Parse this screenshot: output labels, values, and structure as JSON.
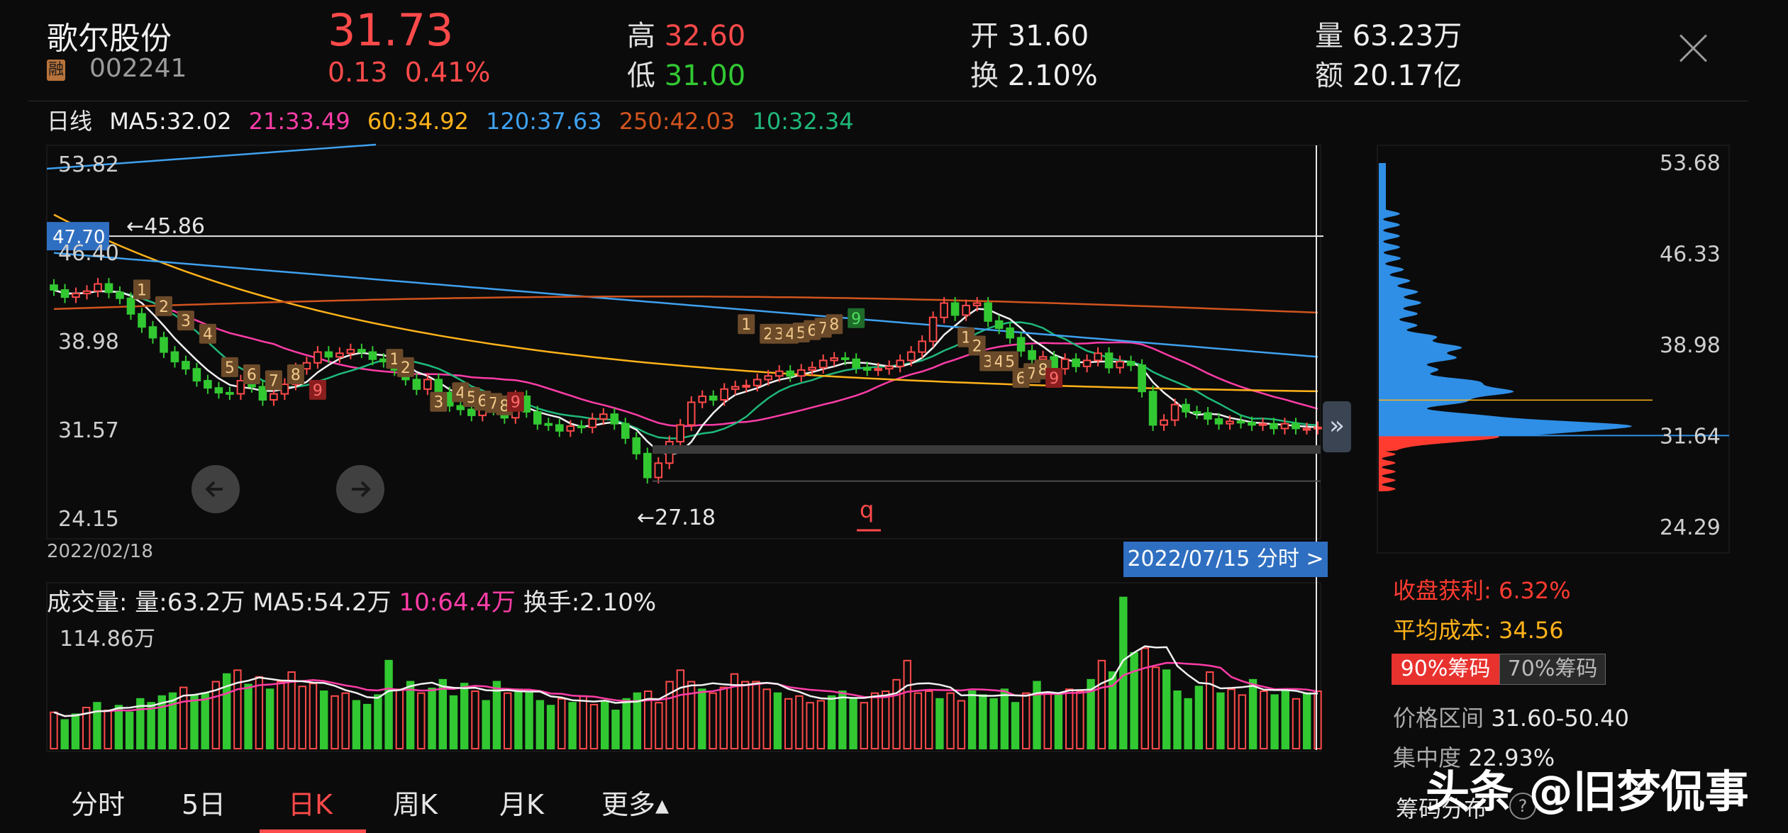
{
  "header": {
    "stock_name": "歌尔股份",
    "badge": "融",
    "code": "002241",
    "price": "31.73",
    "change": "0.13",
    "change_pct": "0.41%",
    "high_label": "高",
    "high": "32.60",
    "low_label": "低",
    "low": "31.00",
    "open_label": "开",
    "open": "31.60",
    "turnover_label": "换",
    "turnover": "2.10%",
    "volume_label": "量",
    "volume": "63.23万",
    "amount_label": "额",
    "amount": "20.17亿"
  },
  "ma_legend": {
    "period": "日线",
    "ma5": "MA5:32.02",
    "ma21": "21:33.49",
    "ma60": "60:34.92",
    "ma120": "120:37.63",
    "ma250": "250:42.03",
    "ma10": "10:32.34"
  },
  "colors": {
    "up": "#ff4a4a",
    "down": "#32c832",
    "ma5": "#f0f0f0",
    "ma21": "#ff3da8",
    "ma60": "#ffb21a",
    "ma120": "#3fa1ef",
    "ma250": "#d2541e",
    "ma10": "#1fb87a",
    "chip_profit": "#ff3b30",
    "chip_loss": "#2f8fe6"
  },
  "chart_data": [
    {
      "type": "candlestick",
      "name": "price",
      "y_ticks": [
        "53.82",
        "46.40",
        "38.98",
        "31.57",
        "24.15"
      ],
      "ylim": [
        24.15,
        53.82
      ],
      "start_date": "2022/02/18",
      "crosshair_price": "47.70",
      "crosshair_date": "2022/07/15 分时 >",
      "annotations": {
        "high_marker": "←45.86",
        "low_marker": "←27.18",
        "q_marker": "q"
      },
      "closes": [
        43.2,
        42.6,
        42.9,
        43.1,
        43.7,
        43.0,
        42.5,
        41.2,
        40.1,
        39.2,
        38.0,
        37.2,
        36.6,
        35.6,
        35.0,
        34.6,
        34.5,
        35.6,
        35.1,
        34.0,
        34.5,
        35.3,
        36.6,
        37.1,
        38.0,
        37.6,
        37.9,
        38.2,
        38.0,
        37.4,
        37.2,
        36.5,
        35.7,
        34.9,
        35.7,
        34.6,
        33.5,
        33.2,
        32.7,
        33.9,
        33.2,
        32.5,
        34.3,
        33.0,
        32.0,
        31.9,
        31.4,
        31.8,
        31.7,
        32.4,
        32.8,
        32.0,
        30.8,
        29.5,
        27.5,
        28.7,
        30.5,
        31.9,
        33.8,
        34.3,
        34.0,
        34.9,
        35.1,
        35.2,
        35.7,
        36.0,
        36.4,
        36.0,
        36.5,
        36.7,
        37.3,
        37.5,
        37.4,
        36.7,
        36.5,
        36.6,
        36.8,
        37.3,
        38.0,
        38.9,
        40.9,
        42.1,
        41.1,
        41.9,
        42.1,
        40.6,
        40.0,
        39.2,
        38.1,
        37.4,
        37.6,
        36.6,
        37.4,
        36.8,
        37.3,
        37.9,
        36.7,
        37.2,
        36.9,
        34.7,
        31.9,
        32.3,
        33.6,
        33.0,
        32.9,
        32.4,
        32.0,
        32.2,
        32.1,
        31.9,
        32.0,
        31.6,
        32.0,
        31.6,
        31.6,
        31.7
      ],
      "opens": [
        43.6,
        43.2,
        42.6,
        42.9,
        43.1,
        43.7,
        43.0,
        42.5,
        41.2,
        40.1,
        39.2,
        38.0,
        37.2,
        36.6,
        35.6,
        35.0,
        34.6,
        34.5,
        35.6,
        35.1,
        34.0,
        34.5,
        35.3,
        36.6,
        37.1,
        38.0,
        37.6,
        37.9,
        38.2,
        38.0,
        37.4,
        37.2,
        36.5,
        35.7,
        34.9,
        35.7,
        34.6,
        33.5,
        33.2,
        32.7,
        33.9,
        33.2,
        32.5,
        34.3,
        33.0,
        32.0,
        31.9,
        31.4,
        31.8,
        31.7,
        32.4,
        32.8,
        32.0,
        30.8,
        29.5,
        27.5,
        28.7,
        30.5,
        31.9,
        33.8,
        34.3,
        34.0,
        34.9,
        35.1,
        35.2,
        35.7,
        36.0,
        36.4,
        36.0,
        36.5,
        36.7,
        37.3,
        37.5,
        37.4,
        36.7,
        36.5,
        36.6,
        36.8,
        37.3,
        38.0,
        38.9,
        40.9,
        42.1,
        41.1,
        41.9,
        42.1,
        40.6,
        40.0,
        39.2,
        38.1,
        37.4,
        37.6,
        36.6,
        37.4,
        36.8,
        37.3,
        37.9,
        36.7,
        37.2,
        36.9,
        34.7,
        31.9,
        32.3,
        33.6,
        33.0,
        32.9,
        32.4,
        32.0,
        32.2,
        32.1,
        31.9,
        32.0,
        31.6,
        32.0,
        31.6,
        31.6
      ],
      "td_labels_down": [
        "1",
        "2",
        "3",
        "4",
        "5",
        "6",
        "7",
        "8",
        "9"
      ],
      "td_labels_up": [
        "1",
        "2",
        "3",
        "4",
        "5",
        "6",
        "7",
        "8",
        "9"
      ]
    },
    {
      "type": "bar",
      "name": "volume",
      "title": "成交量:",
      "legend_vol": "量:63.2万",
      "legend_ma5": "MA5:54.2万",
      "legend_ma10": "10:64.4万",
      "legend_turn": "换手:2.10%",
      "y_tick": "114.86万",
      "ylim": [
        0,
        160
      ],
      "values": [
        38,
        30,
        36,
        43,
        48,
        40,
        45,
        38,
        52,
        48,
        55,
        58,
        64,
        56,
        58,
        70,
        78,
        82,
        67,
        75,
        62,
        70,
        80,
        65,
        68,
        60,
        55,
        58,
        50,
        46,
        56,
        92,
        62,
        70,
        58,
        63,
        72,
        55,
        68,
        60,
        50,
        70,
        58,
        62,
        58,
        50,
        45,
        52,
        48,
        55,
        46,
        50,
        40,
        52,
        58,
        60,
        48,
        70,
        82,
        70,
        62,
        58,
        64,
        78,
        70,
        70,
        62,
        58,
        52,
        55,
        48,
        50,
        55,
        60,
        52,
        48,
        58,
        60,
        72,
        92,
        58,
        60,
        52,
        58,
        50,
        60,
        56,
        52,
        62,
        48,
        58,
        70,
        58,
        56,
        62,
        60,
        72,
        92,
        80,
        158,
        100,
        105,
        85,
        82,
        60,
        52,
        65,
        80,
        58,
        62,
        56,
        72,
        60,
        56,
        62,
        52,
        58,
        60
      ],
      "up_flags": [
        1,
        0,
        0,
        1,
        0,
        1,
        0,
        0,
        0,
        0,
        0,
        0,
        1,
        0,
        0,
        1,
        0,
        1,
        0,
        1,
        0,
        1,
        1,
        1,
        1,
        0,
        1,
        1,
        0,
        0,
        0,
        0,
        1,
        0,
        1,
        0,
        0,
        0,
        0,
        1,
        0,
        0,
        1,
        0,
        0,
        0,
        0,
        1,
        0,
        1,
        1,
        0,
        0,
        0,
        0,
        1,
        1,
        1,
        1,
        1,
        0,
        1,
        1,
        1,
        1,
        1,
        1,
        0,
        1,
        1,
        1,
        1,
        0,
        0,
        0,
        1,
        1,
        1,
        1,
        1,
        1,
        1,
        0,
        1,
        1,
        0,
        0,
        0,
        0,
        0,
        1,
        0,
        1,
        0,
        1,
        1,
        0,
        1,
        0,
        0,
        0,
        1,
        1,
        0,
        0,
        0,
        0,
        1,
        0,
        1,
        1,
        0,
        1,
        0,
        0,
        1,
        0,
        1
      ]
    },
    {
      "type": "chip-distribution",
      "name": "chips",
      "y_ticks": [
        "53.68",
        "46.33",
        "38.98",
        "31.64",
        "24.29"
      ],
      "ylim": [
        24.29,
        53.68
      ]
    }
  ],
  "chip_panel": {
    "profit_label": "收盘获利:",
    "profit_value": "6.32%",
    "avg_cost_label": "平均成本:",
    "avg_cost_value": "34.56",
    "btn_90": "90%筹码",
    "btn_70": "70%筹码",
    "range_label": "价格区间",
    "range_value": "31.60-50.40",
    "concentration_label": "集中度",
    "concentration_value": "22.93%",
    "chip_title": "筹码分布"
  },
  "tabs": [
    "分时",
    "5日",
    "日K",
    "周K",
    "月K",
    "更多▴"
  ],
  "watermark": "头条 @旧梦侃事"
}
